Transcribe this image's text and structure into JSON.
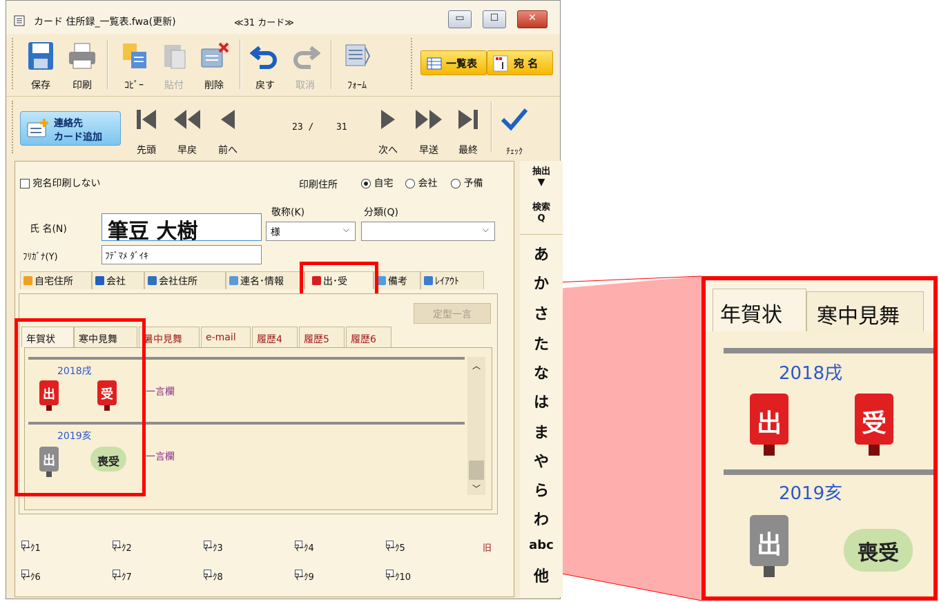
{
  "window": {
    "title": "カード 住所録_一覧表.fwa(更新)",
    "card_count": "≪31 カード≫",
    "min_glyph": "▭",
    "max_glyph": "☐",
    "close_glyph": "✕"
  },
  "toolbar1": {
    "save": "保存",
    "print": "印刷",
    "copy": "ｺﾋﾟｰ",
    "paste": "貼付",
    "delete": "削除",
    "undo": "戻す",
    "cancel": "取消",
    "form": "ﾌｫｰﾑ",
    "list": "一覧表",
    "address": "宛 名"
  },
  "toolbar2": {
    "add_contact": "連絡先",
    "add_card": "カード追加",
    "first": "先頭",
    "fast_back": "早戻",
    "prev": "前へ",
    "position": "23 /",
    "total": "31",
    "next": "次へ",
    "fast_fwd": "早送",
    "last": "最終",
    "check": "ﾁｪｯｸ"
  },
  "form": {
    "no_print_label": "宛名印刷しない",
    "print_address_label": "印刷住所",
    "radio_home": "自宅",
    "radio_company": "会社",
    "radio_spare": "予備",
    "honorific_label": "敬称(K)",
    "category_label": "分類(Q)",
    "name_label": "氏 名(N)",
    "name_value": "筆豆 大樹",
    "honorific_value": "様",
    "category_value": "",
    "furigana_label": "ﾌﾘｶﾞﾅ(Y)",
    "furigana_value": "ﾌﾃﾞﾏﾒ ﾀﾞｲｷ"
  },
  "tabs": [
    "自宅住所",
    "会社",
    "会社住所",
    "連名･情報",
    "出･受",
    "備考",
    "ﾚｲｱｳﾄ"
  ],
  "subpanel": {
    "fixed_phrase_button": "定型一言",
    "tabs": [
      "年賀状",
      "寒中見舞",
      "暑中見舞",
      "e-mail",
      "履歴4",
      "履歴5",
      "履歴6"
    ],
    "rows": [
      {
        "year": "2018戌",
        "sent": "出",
        "received": "受",
        "memo": "一言欄"
      },
      {
        "year": "2019亥",
        "sent": "出",
        "received": "喪受",
        "memo": "一言欄"
      }
    ]
  },
  "marks": [
    "ﾏｰｸ1",
    "ﾏｰｸ2",
    "ﾏｰｸ3",
    "ﾏｰｸ4",
    "ﾏｰｸ5",
    "ﾏｰｸ6",
    "ﾏｰｸ7",
    "ﾏｰｸ8",
    "ﾏｰｸ9",
    "ﾏｰｸ10"
  ],
  "marks_extra": "旧",
  "sidebar": {
    "extract": "抽出",
    "search": "検索",
    "index": [
      "あ",
      "か",
      "さ",
      "た",
      "な",
      "は",
      "ま",
      "や",
      "ら",
      "わ",
      "abc",
      "他"
    ]
  },
  "zoom": {
    "tabs": [
      "年賀状",
      "寒中見舞"
    ],
    "rows": [
      {
        "year": "2018戌",
        "sent": "出",
        "received": "受"
      },
      {
        "year": "2019亥",
        "sent": "出",
        "received": "喪受"
      }
    ]
  },
  "colors": {
    "highlight": "#ff0000",
    "year_text": "#2a58c9",
    "sent_red": "#e02020",
    "sent_gray": "#8c8c8c"
  }
}
